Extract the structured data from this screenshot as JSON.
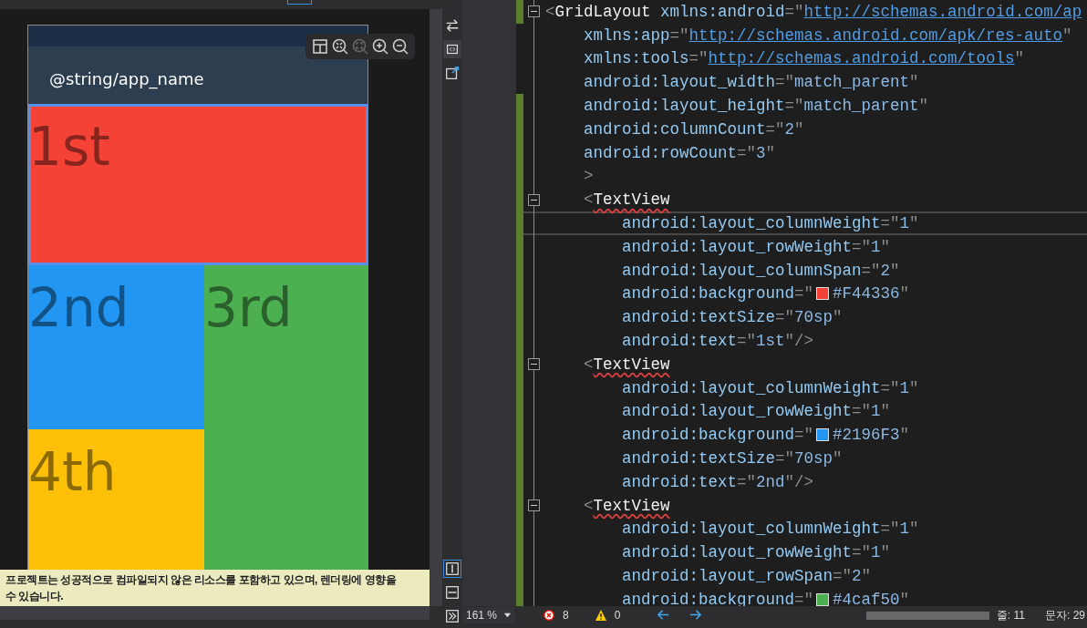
{
  "designer": {
    "zoom_tools": [
      {
        "kind": "layout",
        "disabled": false
      },
      {
        "kind": "fit",
        "disabled": false
      },
      {
        "kind": "actual",
        "disabled": true
      },
      {
        "kind": "zoomin",
        "disabled": false
      },
      {
        "kind": "zoomout",
        "disabled": false
      }
    ],
    "app_title": "@string/app_name",
    "cells": [
      {
        "text": "1st",
        "color": "#f44336",
        "colspan": 2,
        "selected": true
      },
      {
        "text": "2nd",
        "color": "#2196f3",
        "selected": false
      },
      {
        "text": "3rd",
        "color": "#4caf50",
        "rowspan": 2,
        "selected": false
      },
      {
        "text": "4th",
        "color": "#ffc107",
        "selected": false
      }
    ],
    "warning": [
      "프로젝트는 성공적으로 컴파일되지 않은 리소스를 포함하고 있으며, 렌더링에 영향을",
      "수 있습니다."
    ]
  },
  "side_tools": [
    {
      "kind": "swap",
      "selected": false
    },
    {
      "kind": "preview",
      "selected": true
    },
    {
      "kind": "export",
      "selected": false
    }
  ],
  "split_tools": [
    {
      "kind": "vsplit",
      "selected": true
    },
    {
      "kind": "hsplit",
      "selected": false
    },
    {
      "kind": "expand",
      "selected": false
    }
  ],
  "code": [
    {
      "fold": true,
      "changed": true,
      "current": false,
      "tokens": [
        {
          "kind": "p",
          "text": "<"
        },
        {
          "kind": "tag",
          "text": "GridLayout"
        },
        {
          "kind": "attr",
          "text": " xmlns:android"
        },
        {
          "kind": "p",
          "text": "=\""
        },
        {
          "kind": "link",
          "text": "http://schemas.android.com/ap"
        }
      ],
      "children": [
        {
          "fold": false,
          "changed": false,
          "current": false,
          "tokens": [
            {
              "kind": "attr",
              "text": "xmlns:app"
            },
            {
              "kind": "p",
              "text": "=\""
            },
            {
              "kind": "link",
              "text": "http://schemas.android.com/apk/res-auto"
            },
            {
              "kind": "p",
              "text": "\""
            }
          ]
        },
        {
          "fold": false,
          "changed": false,
          "current": false,
          "tokens": [
            {
              "kind": "attr",
              "text": "xmlns:tools"
            },
            {
              "kind": "p",
              "text": "=\""
            },
            {
              "kind": "link",
              "text": "http://schemas.android.com/tools"
            },
            {
              "kind": "p",
              "text": "\""
            }
          ]
        },
        {
          "fold": false,
          "changed": false,
          "current": false,
          "tokens": [
            {
              "kind": "attr",
              "text": "android:layout_width"
            },
            {
              "kind": "p",
              "text": "=\""
            },
            {
              "kind": "val",
              "text": "match_parent"
            },
            {
              "kind": "p",
              "text": "\""
            }
          ]
        },
        {
          "fold": false,
          "changed": true,
          "current": false,
          "tokens": [
            {
              "kind": "attr",
              "text": "android:layout_height"
            },
            {
              "kind": "p",
              "text": "=\""
            },
            {
              "kind": "val",
              "text": "match_parent"
            },
            {
              "kind": "p",
              "text": "\""
            }
          ]
        },
        {
          "fold": false,
          "changed": true,
          "current": false,
          "tokens": [
            {
              "kind": "attr",
              "text": "android:columnCount"
            },
            {
              "kind": "p",
              "text": "=\""
            },
            {
              "kind": "val",
              "text": "2"
            },
            {
              "kind": "p",
              "text": "\""
            }
          ]
        },
        {
          "fold": false,
          "changed": true,
          "current": false,
          "tokens": [
            {
              "kind": "attr",
              "text": "android:rowCount"
            },
            {
              "kind": "p",
              "text": "=\""
            },
            {
              "kind": "val",
              "text": "3"
            },
            {
              "kind": "p",
              "text": "\""
            }
          ]
        },
        {
          "fold": false,
          "changed": true,
          "current": false,
          "tokens": [
            {
              "kind": "p",
              "text": ">"
            }
          ]
        },
        {
          "fold": true,
          "changed": true,
          "current": false,
          "tokens": [
            {
              "kind": "p",
              "text": "<"
            },
            {
              "kind": "tag",
              "text": "TextView",
              "squiggle": true
            }
          ],
          "children": [
            {
              "fold": false,
              "changed": true,
              "current": true,
              "tokens": [
                {
                  "kind": "attr",
                  "text": "android:layout_columnWeight"
                },
                {
                  "kind": "p",
                  "text": "=\""
                },
                {
                  "kind": "val",
                  "text": "1"
                },
                {
                  "kind": "p",
                  "text": "\""
                }
              ]
            },
            {
              "fold": false,
              "changed": true,
              "current": false,
              "tokens": [
                {
                  "kind": "attr",
                  "text": "android:layout_rowWeight"
                },
                {
                  "kind": "p",
                  "text": "=\""
                },
                {
                  "kind": "val",
                  "text": "1"
                },
                {
                  "kind": "p",
                  "text": "\""
                }
              ]
            },
            {
              "fold": false,
              "changed": true,
              "current": false,
              "tokens": [
                {
                  "kind": "attr",
                  "text": "android:layout_columnSpan"
                },
                {
                  "kind": "p",
                  "text": "=\""
                },
                {
                  "kind": "val",
                  "text": "2"
                },
                {
                  "kind": "p",
                  "text": "\""
                }
              ]
            },
            {
              "fold": false,
              "changed": true,
              "current": false,
              "tokens": [
                {
                  "kind": "attr",
                  "text": "android:background"
                },
                {
                  "kind": "p",
                  "text": "=\""
                },
                {
                  "kind": "swatch",
                  "color": "#f44336"
                },
                {
                  "kind": "val",
                  "text": "#F44336"
                },
                {
                  "kind": "p",
                  "text": "\""
                }
              ]
            },
            {
              "fold": false,
              "changed": true,
              "current": false,
              "tokens": [
                {
                  "kind": "attr",
                  "text": "android:textSize"
                },
                {
                  "kind": "p",
                  "text": "=\""
                },
                {
                  "kind": "val",
                  "text": "70sp"
                },
                {
                  "kind": "p",
                  "text": "\""
                }
              ]
            },
            {
              "fold": false,
              "changed": true,
              "current": false,
              "tokens": [
                {
                  "kind": "attr",
                  "text": "android:text"
                },
                {
                  "kind": "p",
                  "text": "=\""
                },
                {
                  "kind": "val",
                  "text": "1st"
                },
                {
                  "kind": "p",
                  "text": "\"/>"
                }
              ]
            }
          ]
        },
        {
          "fold": true,
          "changed": true,
          "current": false,
          "tokens": [
            {
              "kind": "p",
              "text": "<"
            },
            {
              "kind": "tag",
              "text": "TextView",
              "squiggle": true
            }
          ],
          "children": [
            {
              "fold": false,
              "changed": true,
              "current": false,
              "tokens": [
                {
                  "kind": "attr",
                  "text": "android:layout_columnWeight"
                },
                {
                  "kind": "p",
                  "text": "=\""
                },
                {
                  "kind": "val",
                  "text": "1"
                },
                {
                  "kind": "p",
                  "text": "\""
                }
              ]
            },
            {
              "fold": false,
              "changed": true,
              "current": false,
              "tokens": [
                {
                  "kind": "attr",
                  "text": "android:layout_rowWeight"
                },
                {
                  "kind": "p",
                  "text": "=\""
                },
                {
                  "kind": "val",
                  "text": "1"
                },
                {
                  "kind": "p",
                  "text": "\""
                }
              ]
            },
            {
              "fold": false,
              "changed": true,
              "current": false,
              "tokens": [
                {
                  "kind": "attr",
                  "text": "android:background"
                },
                {
                  "kind": "p",
                  "text": "=\""
                },
                {
                  "kind": "swatch",
                  "color": "#2196f3"
                },
                {
                  "kind": "val",
                  "text": "#2196F3"
                },
                {
                  "kind": "p",
                  "text": "\""
                }
              ]
            },
            {
              "fold": false,
              "changed": true,
              "current": false,
              "tokens": [
                {
                  "kind": "attr",
                  "text": "android:textSize"
                },
                {
                  "kind": "p",
                  "text": "=\""
                },
                {
                  "kind": "val",
                  "text": "70sp"
                },
                {
                  "kind": "p",
                  "text": "\""
                }
              ]
            },
            {
              "fold": false,
              "changed": true,
              "current": false,
              "tokens": [
                {
                  "kind": "attr",
                  "text": "android:text"
                },
                {
                  "kind": "p",
                  "text": "=\""
                },
                {
                  "kind": "val",
                  "text": "2nd"
                },
                {
                  "kind": "p",
                  "text": "\"/>"
                }
              ]
            }
          ]
        },
        {
          "fold": true,
          "changed": true,
          "current": false,
          "tokens": [
            {
              "kind": "p",
              "text": "<"
            },
            {
              "kind": "tag",
              "text": "TextView",
              "squiggle": true
            }
          ],
          "children": [
            {
              "fold": false,
              "changed": true,
              "current": false,
              "tokens": [
                {
                  "kind": "attr",
                  "text": "android:layout_columnWeight"
                },
                {
                  "kind": "p",
                  "text": "=\""
                },
                {
                  "kind": "val",
                  "text": "1"
                },
                {
                  "kind": "p",
                  "text": "\""
                }
              ]
            },
            {
              "fold": false,
              "changed": true,
              "current": false,
              "tokens": [
                {
                  "kind": "attr",
                  "text": "android:layout_rowWeight"
                },
                {
                  "kind": "p",
                  "text": "=\""
                },
                {
                  "kind": "val",
                  "text": "1"
                },
                {
                  "kind": "p",
                  "text": "\""
                }
              ]
            },
            {
              "fold": false,
              "changed": true,
              "current": false,
              "tokens": [
                {
                  "kind": "attr",
                  "text": "android:layout_rowSpan"
                },
                {
                  "kind": "p",
                  "text": "=\""
                },
                {
                  "kind": "val",
                  "text": "2"
                },
                {
                  "kind": "p",
                  "text": "\""
                }
              ]
            },
            {
              "fold": false,
              "changed": true,
              "current": false,
              "tokens": [
                {
                  "kind": "attr",
                  "text": "android:background"
                },
                {
                  "kind": "p",
                  "text": "=\""
                },
                {
                  "kind": "swatch",
                  "color": "#4caf50"
                },
                {
                  "kind": "val",
                  "text": "#4caf50"
                },
                {
                  "kind": "p",
                  "text": "\""
                }
              ]
            }
          ]
        }
      ]
    }
  ],
  "status_bar": {
    "zoom": "161 %",
    "errors": "8",
    "warnings": "0",
    "line": "줄: 11",
    "column": "문자: 29"
  }
}
